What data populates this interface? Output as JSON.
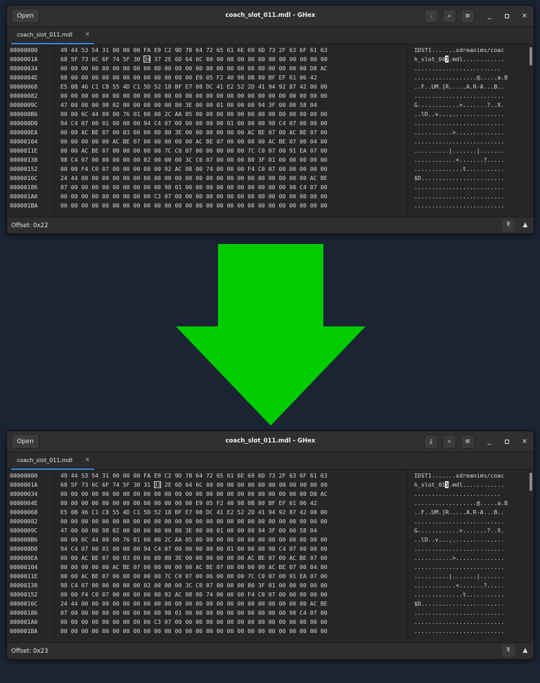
{
  "windows": [
    {
      "open_label": "Open",
      "title": "coach_slot_011.mdl - GHex",
      "tab_label": "coach_slot_011.mdl",
      "save_enabled": false,
      "offsets": [
        "00000000",
        "0000001A",
        "00000034",
        "0000004E",
        "00000068",
        "00000082",
        "0000009C",
        "000000B6",
        "000000D0",
        "000000EA",
        "00000104",
        "0000011E",
        "00000138",
        "00000152",
        "0000016C",
        "00000186",
        "000001A0",
        "000001BA"
      ],
      "hex_rows": [
        "49 44 53 54 31 00 00 00 FA E9 C2 9D 78 64 72 65 61 6E 69 6D 73 2F 63 6F 61 63",
        "68 5F 73 6C 6F 74 5F 30 34 37 2E 6D 64 6C 00 00 00 00 00 00 00 00 00 00 00 00",
        "00 00 00 00 00 00 00 00 00 00 00 00 00 00 00 00 00 00 00 00 00 00 00 00 D8 AC",
        "08 00 00 00 00 00 00 00 00 00 00 00 00 E9 05 F2 40 98 0B 80 BF EF 61 06 42",
        "E5 0B 46 C1 C8 55 4D C1 5D 52 18 BF E7 08 DC 41 E2 52 2D 41 94 92 87 42 00 00",
        "00 00 00 00 00 00 00 00 00 00 00 00 00 00 00 00 00 00 00 00 00 00 00 00 00 00",
        "47 00 00 00 98 02 00 00 00 00 00 80 3E 00 00 01 00 00 00 94 3F 00 00 58 04",
        "00 00 6C 44 00 00 76 01 00 00 2C AA 05 00 00 00 00 00 00 00 00 00 00 00 00 00",
        "94 C4 07 00 01 00 00 00 94 C4 07 00 00 00 00 00 01 00 00 00 98 C4 07 00 00 00",
        "00 00 AC BE 07 00 03 00 00 00 80 3E 00 00 00 00 00 00 AC BE 07 00 AC BE 07 00",
        "00 00 00 00 00 AC BE 07 00 00 00 00 00 AC BE 07 00 00 00 00 AC BE 07 00 04 00",
        "00 00 AC BE 07 00 00 00 00 00 7C C0 07 00 06 00 00 00 7C C0 07 00 91 EA 07 00",
        "98 C4 07 00 00 00 00 00 02 00 00 00 3C C0 07 00 00 00 80 3F 01 00 00 00 00 00",
        "00 00 F4 C0 07 00 00 00 00 00 92 AC 08 00 74 00 00 00 F4 C0 07 00 00 00 00 00",
        "24 44 00 00 00 00 00 00 00 00 00 00 00 00 00 00 00 00 00 00 00 00 00 00 AC BE",
        "07 00 00 00 00 00 00 00 00 00 98 01 00 00 00 00 00 00 00 00 00 00 98 C4 07 00",
        "00 00 00 00 00 00 00 00 00 C3 07 00 00 00 00 00 00 00 00 00 00 00 00 00 00 00",
        "00 00 00 00 00 00 00 00 00 00 00 00 00 00 00 00 00 00 00 00 00 00 00 00 00 00"
      ],
      "ascii_rows": [
        "IDST1.......xdreanims/coac",
        "h_slot_047.mdl............",
        ".........................",
        "..................@.....a.B",
        "..F..UM.]R.....A.R-A...B..",
        "..........................",
        "G............>.......?..X.",
        "..lD..v...,...............",
        "..........................",
        "...........>..............",
        "..........................",
        "..........|.......|.......",
        "............<.......?.....",
        "..............t...........",
        "$D........................",
        "..........................",
        "..........................",
        ".........................."
      ],
      "cursor_row": 1,
      "cursor_hex_index": 8,
      "cursor_ascii_index": 9,
      "offset_label": "Offset: 0x22",
      "encoding_icon": "₹",
      "up_icon": "▲"
    },
    {
      "open_label": "Open",
      "title": "coach_slot_011.mdl - GHex",
      "tab_label": "coach_slot_011.mdl",
      "save_enabled": true,
      "offsets": [
        "00000000",
        "0000001A",
        "00000034",
        "0000004E",
        "00000068",
        "00000082",
        "0000009C",
        "000000B6",
        "000000D0",
        "000000EA",
        "00000104",
        "0000011E",
        "00000138",
        "00000152",
        "0000016C",
        "00000186",
        "000001A0",
        "000001BA"
      ],
      "hex_rows": [
        "49 44 53 54 31 00 00 00 FA E9 C2 9D 78 64 72 65 61 6E 69 6D 73 2F 63 6F 61 63",
        "68 5F 73 6C 6F 74 5F 30 31 31 2E 6D 64 6C 00 00 00 00 00 00 00 00 00 00 00 00",
        "00 00 00 00 00 00 00 00 00 00 00 00 00 00 00 00 00 00 00 00 00 00 00 00 D8 AC",
        "08 00 00 00 00 00 00 00 00 00 00 00 00 E9 05 F2 40 98 0B 80 BF EF 61 06 42",
        "E5 0B 46 C1 C8 55 4D C1 5D 52 18 BF E7 08 DC 41 E2 52 2D 41 94 92 87 42 00 00",
        "00 00 00 00 00 00 00 00 00 00 00 00 00 00 00 00 00 00 00 00 00 00 00 00 00 00",
        "47 00 00 00 98 02 00 00 00 00 00 80 3E 00 00 01 00 00 00 94 3F 00 00 58 04",
        "00 00 6C 44 00 00 76 01 00 00 2C AA 05 00 00 00 00 00 00 00 00 00 00 00 00 00",
        "94 C4 07 00 01 00 00 00 94 C4 07 00 00 00 00 00 01 00 00 00 98 C4 07 00 00 00",
        "00 00 AC BE 07 00 03 00 00 00 80 3E 00 00 00 00 00 00 AC BE 07 00 AC BE 07 00",
        "00 00 00 00 00 AC BE 07 00 00 00 00 00 AC BE 07 00 00 00 00 AC BE 07 00 04 00",
        "00 00 AC BE 07 00 00 00 00 00 7C C0 07 00 06 00 00 00 7C C0 07 00 91 EA 07 00",
        "98 C4 07 00 00 00 00 00 02 00 00 00 3C C0 07 00 00 00 80 3F 01 00 00 00 00 00",
        "00 00 F4 C0 07 00 00 00 00 00 92 AC 08 00 74 00 00 00 F4 C0 07 00 00 00 00 00",
        "24 44 00 00 00 00 00 00 00 00 00 00 00 00 00 00 00 00 00 00 00 00 00 00 AC BE",
        "07 00 00 00 00 00 00 00 00 00 98 01 00 00 00 00 00 00 00 00 00 00 98 C4 07 00",
        "00 00 00 00 00 00 00 00 00 C3 07 00 00 00 00 00 00 00 00 00 00 00 00 00 00 00",
        "00 00 00 00 00 00 00 00 00 00 00 00 00 00 00 00 00 00 00 00 00 00 00 00 00 00"
      ],
      "ascii_rows": [
        "IDST1.......xdreanims/coac",
        "h_slot_011.mdl............",
        ".........................",
        "..................@.....a.B",
        "..F..UM.]R.....A.R-A...B..",
        "..........................",
        "G............>.......?..X.",
        "..lD..v...,...............",
        "..........................",
        "...........>..............",
        "..........................",
        "..........|.......|.......",
        "............<.......?.....",
        "..............t...........",
        "$D........................",
        "..........................",
        "..........................",
        ".........................."
      ],
      "cursor_row": 1,
      "cursor_hex_index": 9,
      "cursor_ascii_index": 9,
      "offset_label": "Offset: 0x23",
      "encoding_icon": "₹",
      "up_icon": "▲"
    }
  ],
  "arrow_color": "#00cc00",
  "colors": {
    "background": "#1a2433",
    "tab_accent": "#3584e4"
  }
}
